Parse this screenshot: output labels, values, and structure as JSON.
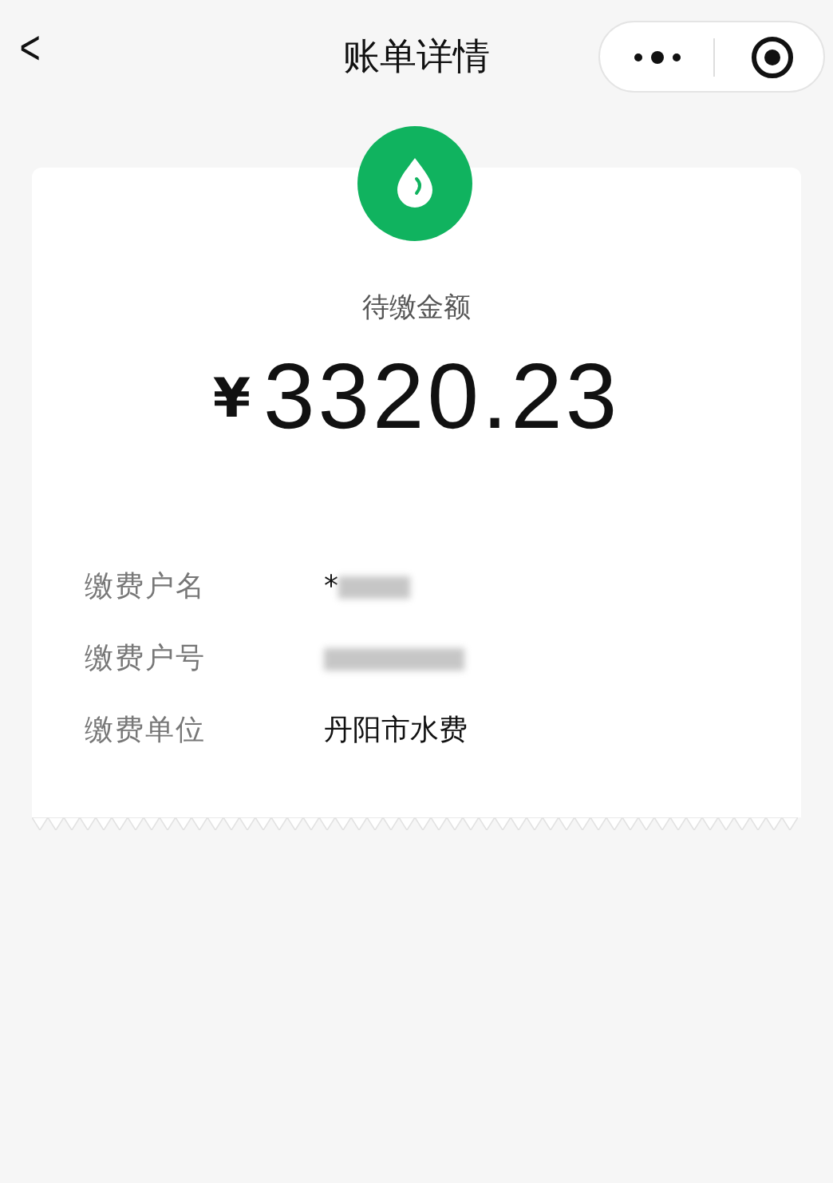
{
  "nav": {
    "back": "<",
    "title": "账单详情"
  },
  "bill": {
    "amount_label": "待缴金额",
    "currency": "¥",
    "amount": "3320.23"
  },
  "rows": [
    {
      "label": "缴费户名",
      "value": "*",
      "redacted": true
    },
    {
      "label": "缴费户号",
      "value": "",
      "redacted": true
    },
    {
      "label": "缴费单位",
      "value": "丹阳市水费",
      "redacted": false
    }
  ]
}
